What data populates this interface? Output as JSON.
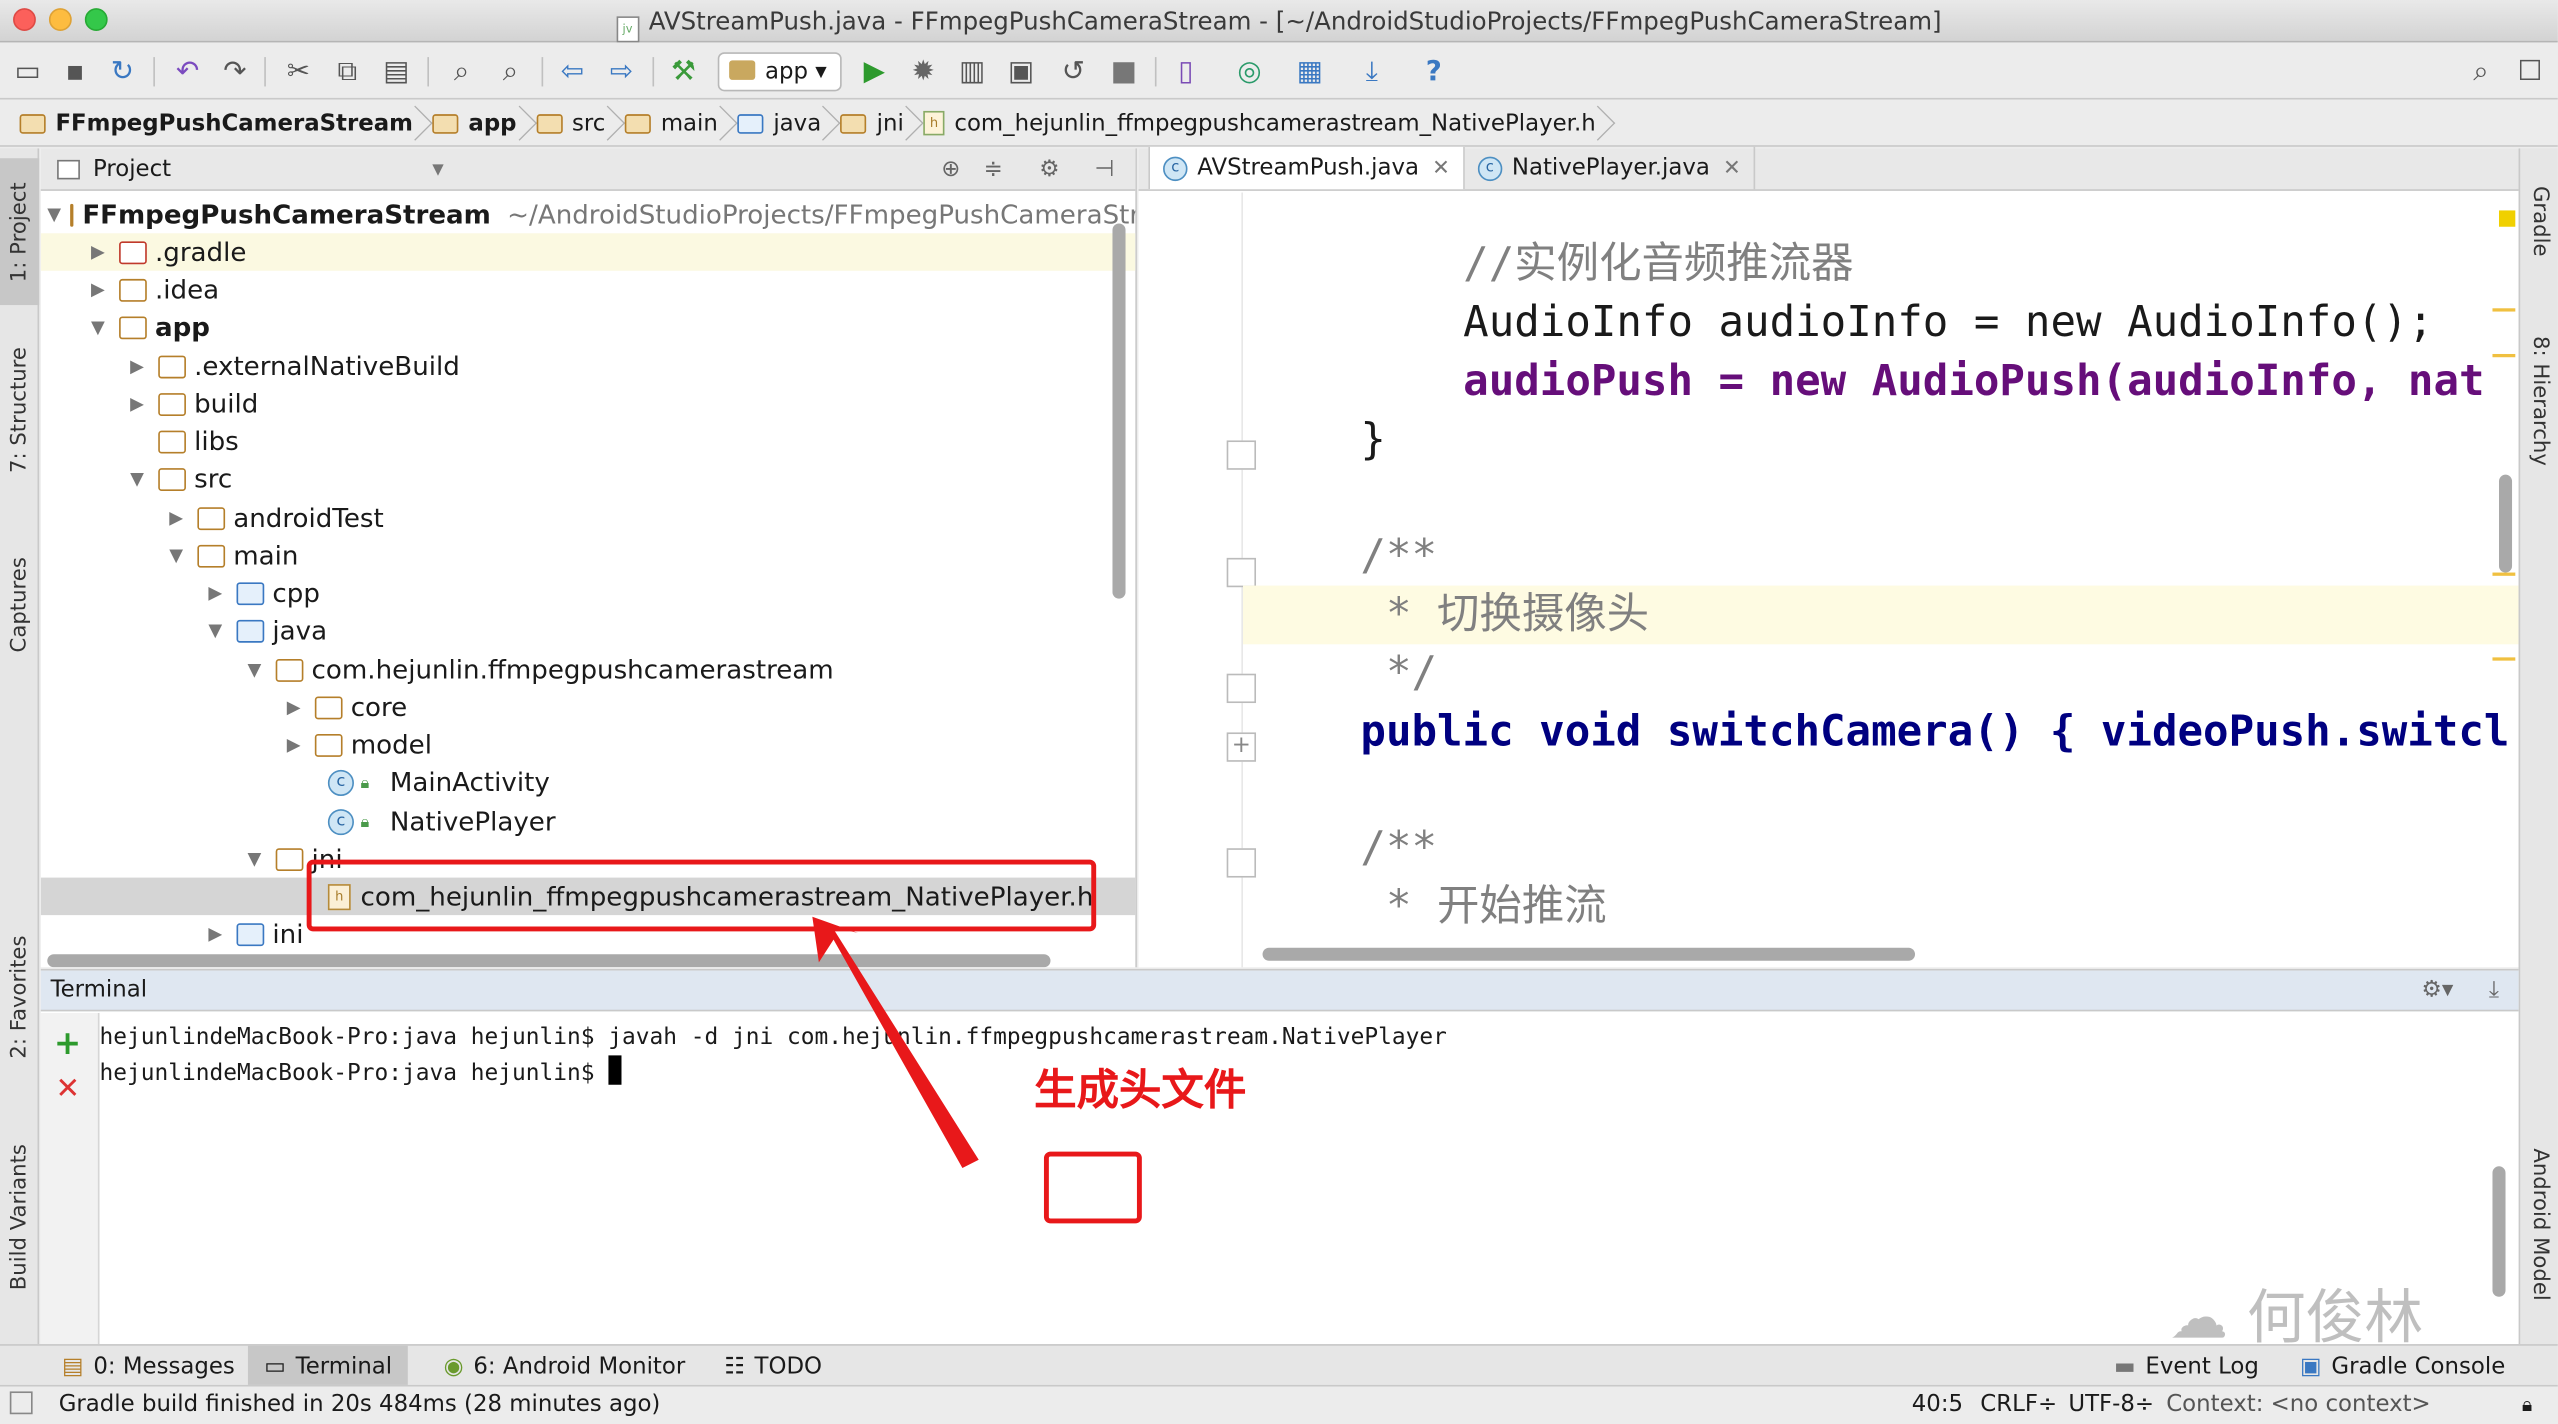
{
  "window": {
    "title": "AVStreamPush.java - FFmpegPushCameraStream - [~/AndroidStudioProjects/FFmpegPushCameraStream]"
  },
  "toolbar": {
    "run_config": "app",
    "help": "?"
  },
  "breadcrumb": [
    "FFmpegPushCameraStream",
    "app",
    "src",
    "main",
    "java",
    "jni",
    "com_hejunlin_ffmpegpushcamerastream_NativePlayer.h"
  ],
  "left_tools": [
    "1: Project",
    "7: Structure",
    "Captures",
    "2: Favorites",
    "Build Variants"
  ],
  "right_tools": [
    "Gradle",
    "8: Hierarchy",
    "Android Model"
  ],
  "project": {
    "header": "Project",
    "root_name": "FFmpegPushCameraStream",
    "root_path": "~/AndroidStudioProjects/FFmpegPushCameraStr",
    "nodes": [
      ".gradle",
      ".idea",
      "app",
      ".externalNativeBuild",
      "build",
      "libs",
      "src",
      "androidTest",
      "main",
      "cpp",
      "java",
      "com.hejunlin.ffmpegpushcamerastream",
      "core",
      "model",
      "MainActivity",
      "NativePlayer",
      "jni",
      "com_hejunlin_ffmpegpushcamerastream_NativePlayer.h",
      "ini"
    ]
  },
  "editor": {
    "tabs": [
      {
        "label": "AVStreamPush.java",
        "active": true
      },
      {
        "label": "NativePlayer.java",
        "active": false
      }
    ],
    "lines": [
      "//实例化音频推流器",
      "AudioInfo audioInfo = new AudioInfo();",
      "audioPush = new AudioPush(audioInfo, nat",
      "}",
      "/**",
      " * 切换摄像头",
      " */",
      "public void switchCamera() { videoPush.switcl",
      "/**",
      " * 开始推流"
    ]
  },
  "terminal": {
    "title": "Terminal",
    "lines": [
      "hejunlindeMacBook-Pro:java hejunlin$ javah -d jni com.hejunlin.ffmpegpushcamerastream.NativePlayer",
      "hejunlindeMacBook-Pro:java hejunlin$ "
    ]
  },
  "bottom_tabs": [
    "0: Messages",
    "Terminal",
    "6: Android Monitor",
    "TODO",
    "Event Log",
    "Gradle Console"
  ],
  "status": {
    "message": "Gradle build finished in 20s 484ms (28 minutes ago)",
    "position": "40:5",
    "line_sep": "CRLF",
    "encoding": "UTF-8",
    "context": "Context: <no context>"
  },
  "annotation": {
    "label": "生成头文件"
  },
  "watermark": "何俊林"
}
